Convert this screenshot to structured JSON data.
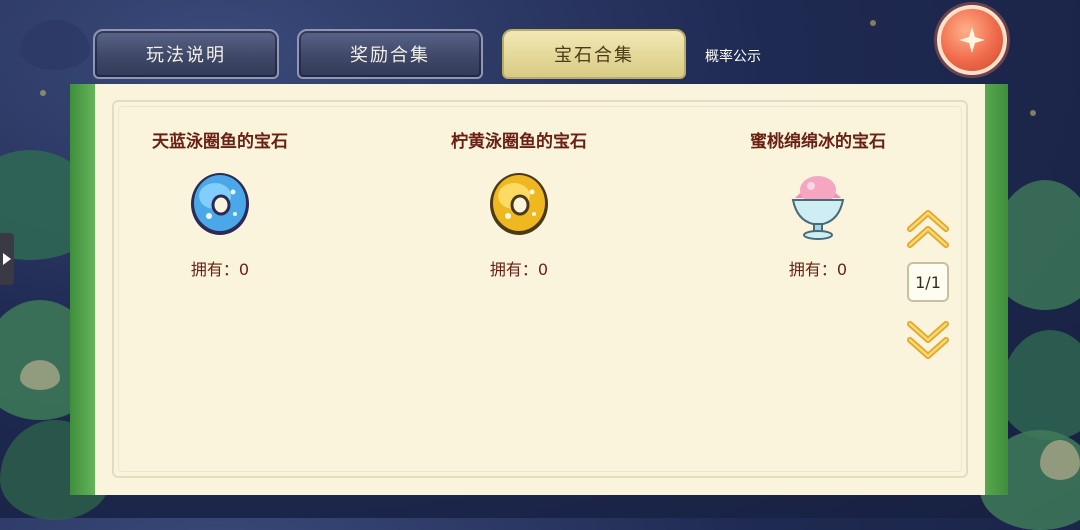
{
  "tabs": [
    {
      "label": "玩法说明",
      "active": false
    },
    {
      "label": "奖励合集",
      "active": false
    },
    {
      "label": "宝石合集",
      "active": true
    }
  ],
  "probability_link": "概率公示",
  "gems": [
    {
      "name": "天蓝泳圈鱼的宝石",
      "owned_label": "拥有：0",
      "icon": "blue-ring-gem-icon"
    },
    {
      "name": "柠黄泳圈鱼的宝石",
      "owned_label": "拥有：0",
      "icon": "yellow-ring-gem-icon"
    },
    {
      "name": "蜜桃绵绵冰的宝石",
      "owned_label": "拥有：0",
      "icon": "shaved-ice-gem-icon"
    }
  ],
  "pagination": {
    "page_label": "1/1"
  },
  "colors": {
    "panel_bg": "#faf4dc",
    "panel_border_green": "#5aa84e",
    "text_dark_red": "#6a1f12",
    "active_tab": "#e6da98",
    "close_button": "#f06a4a"
  }
}
